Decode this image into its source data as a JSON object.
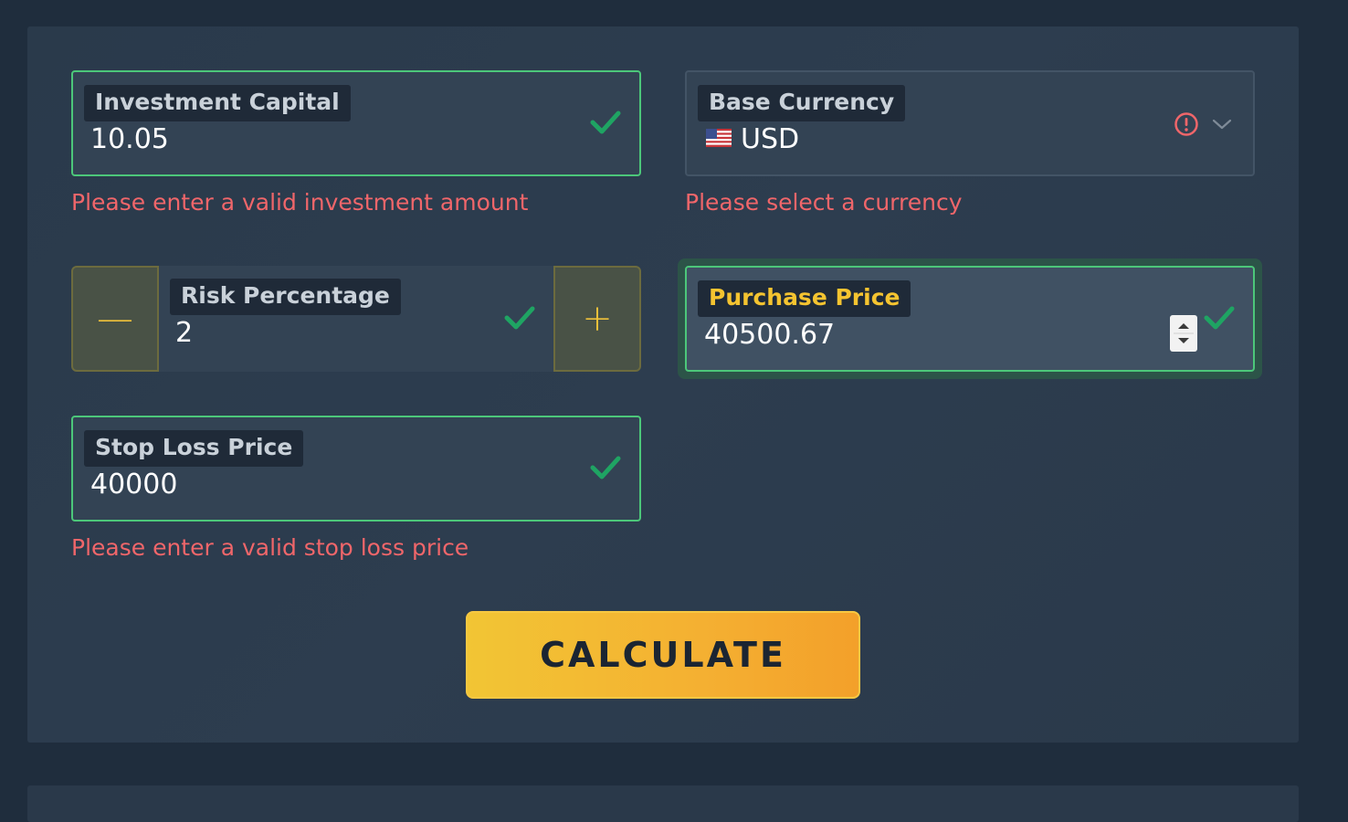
{
  "form": {
    "investment": {
      "label": "Investment Capital",
      "value": "10.05",
      "error": "Please enter a valid investment amount"
    },
    "currency": {
      "label": "Base Currency",
      "value": "USD",
      "flag": "us-flag-icon",
      "error": "Please select a currency"
    },
    "risk": {
      "label": "Risk Percentage",
      "value": "2",
      "minus": "—",
      "plus": "+"
    },
    "purchase": {
      "label": "Purchase Price",
      "value": "40500.67"
    },
    "stop_loss": {
      "label": "Stop Loss Price",
      "value": "40000",
      "error": "Please enter a valid stop loss price"
    },
    "calculate_label": "CALCULATE"
  },
  "colors": {
    "accent": "#f4b032",
    "valid": "#4cc77a",
    "error": "#f0666a",
    "background": "#1f2d3d"
  }
}
